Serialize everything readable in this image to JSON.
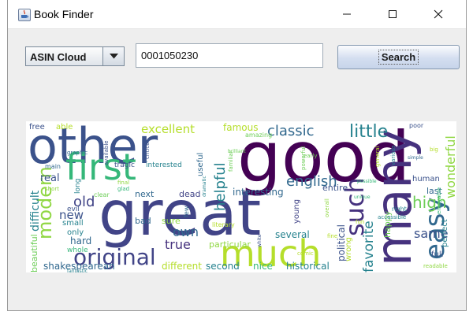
{
  "window": {
    "title": "Book Finder"
  },
  "controls": {
    "source_selected": "ASIN Cloud",
    "asin_value": "0001050230",
    "search_label": "Search"
  },
  "colors": {
    "purple": "#440154",
    "indigo": "#414487",
    "blue": "#31688e",
    "teal": "#26828e",
    "green": "#35b779",
    "yellowgreen": "#b5de2b",
    "lime": "#90d743"
  },
  "word_cloud": {
    "words": [
      {
        "text": "good",
        "color": "#440154"
      },
      {
        "text": "great",
        "color": "#414487"
      },
      {
        "text": "other",
        "color": "#3b528b"
      },
      {
        "text": "many",
        "color": "#46327e"
      },
      {
        "text": "much",
        "color": "#b5de2b"
      },
      {
        "text": "first",
        "color": "#35b779"
      },
      {
        "text": "original",
        "color": "#414487"
      },
      {
        "text": "modern",
        "color": "#90d743"
      },
      {
        "text": "easy",
        "color": "#31688e"
      },
      {
        "text": "such",
        "color": "#46327e"
      },
      {
        "text": "classic",
        "color": "#31688e"
      },
      {
        "text": "little",
        "color": "#26828e"
      },
      {
        "text": "excellent",
        "color": "#b5de2b"
      },
      {
        "text": "english",
        "color": "#31688e"
      },
      {
        "text": "helpful",
        "color": "#26828e"
      },
      {
        "text": "high",
        "color": "#6ece58"
      },
      {
        "text": "wonderful",
        "color": "#90d743"
      },
      {
        "text": "favorite",
        "color": "#26828e"
      },
      {
        "text": "same",
        "color": "#3b528b"
      },
      {
        "text": "old",
        "color": "#414487"
      },
      {
        "text": "new",
        "color": "#3b528b"
      },
      {
        "text": "own",
        "color": "#31688e"
      },
      {
        "text": "true",
        "color": "#46327e"
      },
      {
        "text": "difficult",
        "color": "#26828e"
      },
      {
        "text": "famous",
        "color": "#b5de2b"
      },
      {
        "text": "interesting",
        "color": "#31688e"
      },
      {
        "text": "real",
        "color": "#3b528b"
      },
      {
        "text": "beautiful",
        "color": "#6ece58"
      },
      {
        "text": "shakespearean",
        "color": "#31688e"
      },
      {
        "text": "different",
        "color": "#b5de2b"
      },
      {
        "text": "second",
        "color": "#26828e"
      },
      {
        "text": "nice",
        "color": "#35b779"
      },
      {
        "text": "historical",
        "color": "#26828e"
      },
      {
        "text": "particular",
        "color": "#90d743"
      },
      {
        "text": "several",
        "color": "#26828e"
      },
      {
        "text": "political",
        "color": "#3b528b"
      },
      {
        "text": "young",
        "color": "#414487"
      },
      {
        "text": "entire",
        "color": "#3b528b"
      },
      {
        "text": "human",
        "color": "#3b528b"
      },
      {
        "text": "last",
        "color": "#31688e"
      },
      {
        "text": "perfect",
        "color": "#26828e"
      },
      {
        "text": "full",
        "color": "#3b528b"
      },
      {
        "text": "happy",
        "color": "#6ece58"
      },
      {
        "text": "wrong",
        "color": "#b5de2b"
      },
      {
        "text": "free",
        "color": "#3b528b"
      },
      {
        "text": "able",
        "color": "#b5de2b"
      },
      {
        "text": "hard",
        "color": "#31688e"
      },
      {
        "text": "whole",
        "color": "#35b779"
      },
      {
        "text": "only",
        "color": "#26828e"
      },
      {
        "text": "small",
        "color": "#26828e"
      },
      {
        "text": "evil",
        "color": "#3b528b"
      },
      {
        "text": "next",
        "color": "#31688e"
      },
      {
        "text": "dead",
        "color": "#414487"
      },
      {
        "text": "bad",
        "color": "#31688e"
      },
      {
        "text": "sure",
        "color": "#90d743"
      },
      {
        "text": "tragic",
        "color": "#3b528b"
      },
      {
        "text": "interested",
        "color": "#26828e"
      },
      {
        "text": "useful",
        "color": "#31688e"
      },
      {
        "text": "amazing",
        "color": "#6ece58"
      },
      {
        "text": "main",
        "color": "#31688e"
      },
      {
        "text": "short",
        "color": "#90d743"
      },
      {
        "text": "long",
        "color": "#26828e"
      },
      {
        "text": "clear",
        "color": "#6ece58"
      },
      {
        "text": "literary",
        "color": "#b5de2b"
      },
      {
        "text": "right",
        "color": "#26828e"
      },
      {
        "text": "readable",
        "color": "#90d743"
      },
      {
        "text": "comic",
        "color": "#b5de2b"
      },
      {
        "text": "fine",
        "color": "#b5de2b"
      },
      {
        "text": "poor",
        "color": "#3b528b"
      },
      {
        "text": "various",
        "color": "#26828e"
      },
      {
        "text": "general",
        "color": "#b5de2b"
      },
      {
        "text": "powerful",
        "color": "#6ece58"
      },
      {
        "text": "early",
        "color": "#6ece58"
      },
      {
        "text": "available",
        "color": "#3b528b"
      },
      {
        "text": "graphic",
        "color": "#31688e"
      },
      {
        "text": "critical",
        "color": "#3b528b"
      },
      {
        "text": "familiar",
        "color": "#6ece58"
      },
      {
        "text": "final",
        "color": "#90d743"
      },
      {
        "text": "glad",
        "color": "#35b779"
      },
      {
        "text": "fantastic",
        "color": "#26828e"
      },
      {
        "text": "enjoyable",
        "color": "#35b779"
      },
      {
        "text": "accessible",
        "color": "#26828e"
      },
      {
        "text": "overall",
        "color": "#90d743"
      },
      {
        "text": "white",
        "color": "#3b528b"
      },
      {
        "text": "fun",
        "color": "#b5de2b"
      },
      {
        "text": "big",
        "color": "#b5de2b"
      },
      {
        "text": "simple",
        "color": "#31688e"
      },
      {
        "text": "possible",
        "color": "#35b779"
      },
      {
        "text": "dramatic",
        "color": "#26828e"
      },
      {
        "text": "few",
        "color": "#31688e"
      },
      {
        "text": "unique",
        "color": "#35b779"
      },
      {
        "text": "brilliant",
        "color": "#6ece58"
      }
    ]
  }
}
